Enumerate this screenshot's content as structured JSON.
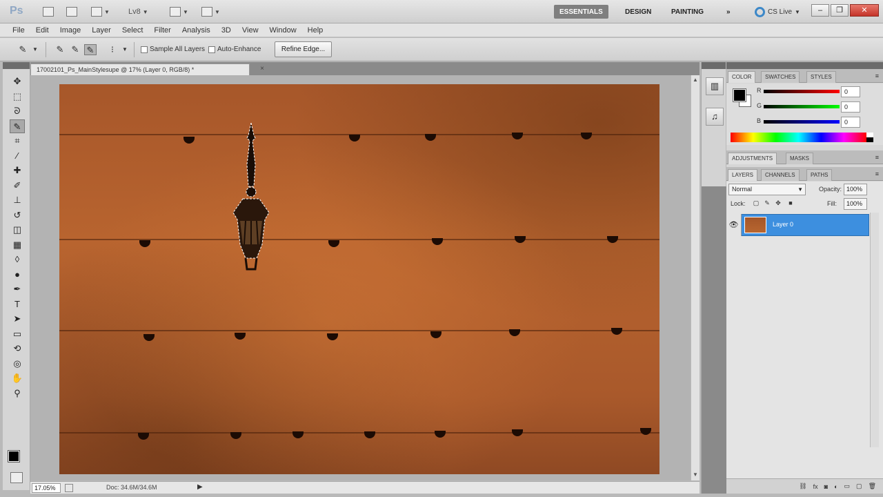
{
  "app": {
    "logo": "Ps",
    "zoom": "Lv8",
    "colors": {
      "accent": "#3d8fdf",
      "chrome": "#d5d5d5",
      "wood": "#a9592b"
    }
  },
  "workspaces": [
    {
      "label": "ESSENTIALS",
      "active": true
    },
    {
      "label": "DESIGN",
      "active": false
    },
    {
      "label": "PAINTING",
      "active": false
    }
  ],
  "workspaces_more": "»",
  "cs_live": "CS Live",
  "window": {
    "minimize": "–",
    "restore": "❐",
    "close": "✕"
  },
  "menu": [
    "File",
    "Edit",
    "Image",
    "Layer",
    "Select",
    "Filter",
    "Analysis",
    "3D",
    "View",
    "Window",
    "Help"
  ],
  "options": {
    "sample_all_layers": "Sample All Layers",
    "auto_enhance": "Auto-Enhance",
    "refine_edge": "Refine Edge..."
  },
  "document": {
    "tab_title": "17002101_Ps_MainStylesupe @ 17% (Layer 0, RGB/8) *",
    "close": "×",
    "zoom": "17.05%",
    "doc_info": "Doc: 34.6M/34.6M"
  },
  "tools": [
    {
      "name": "move-tool-icon",
      "glyph": "✥"
    },
    {
      "name": "marquee-tool-icon",
      "glyph": "⬚"
    },
    {
      "name": "lasso-tool-icon",
      "glyph": "ᘐ"
    },
    {
      "name": "quick-selection-tool-icon",
      "glyph": "✎",
      "selected": true
    },
    {
      "name": "crop-tool-icon",
      "glyph": "⌗"
    },
    {
      "name": "eyedropper-tool-icon",
      "glyph": "⁄"
    },
    {
      "name": "healing-brush-tool-icon",
      "glyph": "✚"
    },
    {
      "name": "brush-tool-icon",
      "glyph": "✐"
    },
    {
      "name": "clone-stamp-tool-icon",
      "glyph": "⊥"
    },
    {
      "name": "history-brush-tool-icon",
      "glyph": "↺"
    },
    {
      "name": "eraser-tool-icon",
      "glyph": "◫"
    },
    {
      "name": "gradient-tool-icon",
      "glyph": "▦"
    },
    {
      "name": "blur-tool-icon",
      "glyph": "◊"
    },
    {
      "name": "dodge-tool-icon",
      "glyph": "●"
    },
    {
      "name": "pen-tool-icon",
      "glyph": "✒"
    },
    {
      "name": "type-tool-icon",
      "glyph": "T"
    },
    {
      "name": "path-selection-tool-icon",
      "glyph": "➤"
    },
    {
      "name": "shape-tool-icon",
      "glyph": "▭"
    },
    {
      "name": "3d-rotate-tool-icon",
      "glyph": "⟲"
    },
    {
      "name": "3d-orbit-tool-icon",
      "glyph": "◎"
    },
    {
      "name": "hand-tool-icon",
      "glyph": "✋"
    },
    {
      "name": "zoom-tool-icon",
      "glyph": "⚲"
    }
  ],
  "color_panel": {
    "tabs": [
      "COLOR",
      "SWATCHES",
      "STYLES"
    ],
    "r": {
      "label": "R",
      "value": "0"
    },
    "g": {
      "label": "G",
      "value": "0"
    },
    "b": {
      "label": "B",
      "value": "0"
    }
  },
  "adjustments_panel": {
    "tabs": [
      "ADJUSTMENTS",
      "MASKS"
    ]
  },
  "layers_panel": {
    "tabs": [
      "LAYERS",
      "CHANNELS",
      "PATHS"
    ],
    "blend_mode": "Normal",
    "opacity_label": "Opacity:",
    "opacity": "100%",
    "lock_label": "Lock:",
    "fill_label": "Fill:",
    "fill": "100%",
    "layers": [
      {
        "name": "Layer 0",
        "visible": true,
        "selected": true
      }
    ],
    "footer_icons": [
      "link-layers-icon",
      "layer-style-icon",
      "add-mask-icon",
      "adjustment-layer-icon",
      "new-group-icon",
      "new-layer-icon",
      "delete-layer-icon"
    ]
  }
}
